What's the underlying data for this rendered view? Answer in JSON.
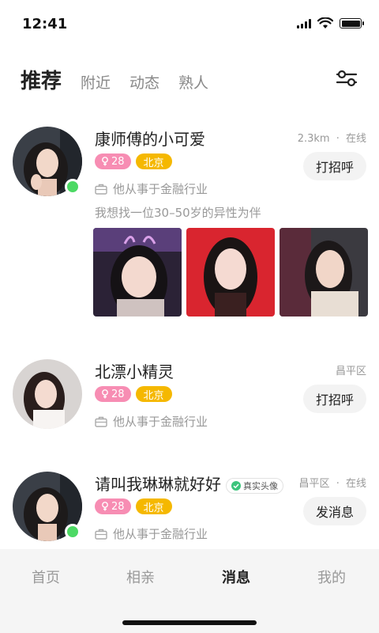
{
  "status_bar": {
    "time": "12:41"
  },
  "top_tabs": [
    {
      "label": "推荐",
      "active": true
    },
    {
      "label": "附近",
      "active": false
    },
    {
      "label": "动态",
      "active": false
    },
    {
      "label": "熟人",
      "active": false
    }
  ],
  "colors": {
    "online": "#4cd964",
    "age_tag": "#f78db3",
    "city_tag": "#f5b800"
  },
  "icons": [
    "signal-icon",
    "wifi-icon",
    "battery-icon",
    "filter-icon",
    "briefcase-icon",
    "female-icon",
    "verified-check-icon"
  ],
  "cards": [
    {
      "name": "康师傅的小可爱",
      "distance": "2.3km",
      "meta_separator": "·",
      "online_status": "在线",
      "age": "28",
      "city": "北京",
      "job": "他从事于金融行业",
      "intro": "我想找一位30–50岁的异性为伴",
      "action": "打招呼"
    },
    {
      "name": "北漂小精灵",
      "location": "昌平区",
      "age": "28",
      "city": "北京",
      "job": "他从事于金融行业",
      "action": "打招呼"
    },
    {
      "name": "请叫我琳琳就好好",
      "verified_label": "真实头像",
      "location": "昌平区",
      "meta_separator": "·",
      "online_status": "在线",
      "age": "28",
      "city": "北京",
      "job": "他从事于金融行业",
      "action": "发消息"
    }
  ],
  "bottom_nav": [
    {
      "label": "首页",
      "active": false
    },
    {
      "label": "相亲",
      "active": false
    },
    {
      "label": "消息",
      "active": true
    },
    {
      "label": "我的",
      "active": false
    }
  ]
}
